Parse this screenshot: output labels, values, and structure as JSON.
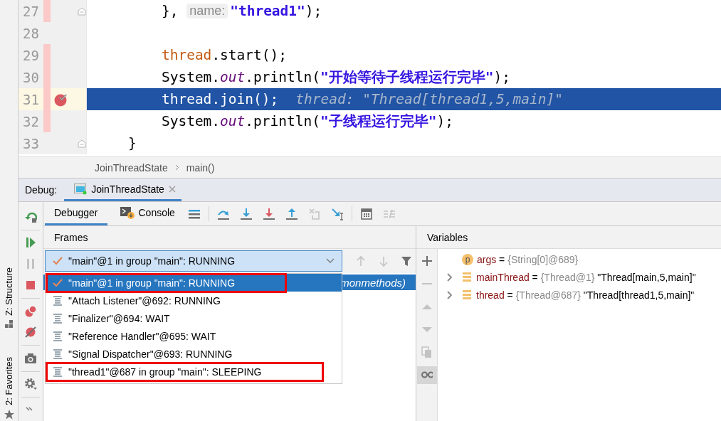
{
  "side_tool_tabs": [
    {
      "label": "Z: Structure",
      "kind": "structure"
    },
    {
      "label": "2: Favorites",
      "kind": "favorites"
    }
  ],
  "editor": {
    "lines": [
      {
        "number": "27",
        "changed": true,
        "breakpoint": false,
        "current": false,
        "fold": true,
        "segments": [
          {
            "kind": "plain",
            "text": "        }, "
          },
          {
            "kind": "hint",
            "text": "name:"
          },
          {
            "kind": "string",
            "text": "\"thread1\""
          },
          {
            "kind": "plain",
            "text": ");"
          }
        ]
      },
      {
        "number": "28",
        "changed": false,
        "breakpoint": false,
        "current": false,
        "fold": false
      },
      {
        "number": "29",
        "changed": true,
        "breakpoint": false,
        "current": false,
        "fold": false,
        "segments": [
          {
            "kind": "local",
            "text": "        thread"
          },
          {
            "kind": "plain",
            "text": ".start();"
          }
        ]
      },
      {
        "number": "30",
        "changed": true,
        "breakpoint": false,
        "current": false,
        "fold": false,
        "segments": [
          {
            "kind": "plain",
            "text": "        System."
          },
          {
            "kind": "static",
            "text": "out"
          },
          {
            "kind": "plain",
            "text": ".println("
          },
          {
            "kind": "string",
            "text": "\"开始等待子线程运行完毕\""
          },
          {
            "kind": "plain",
            "text": ");"
          }
        ]
      },
      {
        "number": "31",
        "changed": true,
        "breakpoint": true,
        "current": true,
        "fold": false,
        "segments": [
          {
            "kind": "local",
            "text": "        thread"
          },
          {
            "kind": "plain",
            "text": ".join();"
          },
          {
            "kind": "inline_value",
            "text": "thread: \"Thread[thread1,5,main]\""
          }
        ]
      },
      {
        "number": "32",
        "changed": true,
        "breakpoint": false,
        "current": false,
        "fold": false,
        "segments": [
          {
            "kind": "plain",
            "text": "        System."
          },
          {
            "kind": "static",
            "text": "out"
          },
          {
            "kind": "plain",
            "text": ".println("
          },
          {
            "kind": "string",
            "text": "\"子线程运行完毕\""
          },
          {
            "kind": "plain",
            "text": ");"
          }
        ]
      },
      {
        "number": "33",
        "changed": false,
        "breakpoint": false,
        "current": false,
        "fold": true,
        "segments": [
          {
            "kind": "plain",
            "text": "    }"
          }
        ]
      }
    ]
  },
  "breadcrumbs": [
    "JoinThreadState",
    "main()"
  ],
  "debug": {
    "label": "Debug:",
    "tabs": [
      {
        "label": "JoinThreadState",
        "selected": true
      }
    ],
    "side_actions": [
      {
        "kind": "rerun",
        "disabled": false
      },
      {
        "kind": "resume",
        "disabled": false
      },
      {
        "kind": "pause",
        "disabled": true
      },
      {
        "kind": "stop",
        "disabled": false
      },
      {
        "kind": "breakpoints",
        "disabled": false
      },
      {
        "kind": "mute",
        "disabled": false
      },
      {
        "kind": "camera",
        "disabled": false
      },
      {
        "kind": "settings",
        "disabled": false
      },
      {
        "kind": "more",
        "disabled": false
      }
    ],
    "view_tabs": [
      {
        "label": "Debugger",
        "selected": true,
        "kind": "debugger"
      },
      {
        "label": "Console",
        "selected": false,
        "kind": "console"
      }
    ],
    "actions": [
      {
        "kind": "layout",
        "disabled": false
      },
      {
        "kind": "step_over",
        "disabled": false
      },
      {
        "kind": "step_into",
        "disabled": false
      },
      {
        "kind": "force_step_into",
        "disabled": false
      },
      {
        "kind": "step_out",
        "disabled": false
      },
      {
        "kind": "drop_frame",
        "disabled": true
      },
      {
        "kind": "run_to_cursor",
        "disabled": false
      },
      {
        "kind": "evaluate",
        "disabled": false
      },
      {
        "kind": "trace",
        "disabled": true
      }
    ]
  },
  "frames": {
    "title": "Frames",
    "thread_selector": {
      "value": "\"main\"@1 in group \"main\": RUNNING"
    },
    "nav": [
      {
        "kind": "up",
        "disabled": true
      },
      {
        "kind": "down",
        "disabled": true
      },
      {
        "kind": "filter",
        "disabled": false
      }
    ],
    "list": [
      {
        "text": "monmethods)",
        "selected": true
      }
    ],
    "popup": [
      {
        "kind": "current",
        "text": "\"main\"@1 in group \"main\": RUNNING",
        "selected": true,
        "highlighted": true
      },
      {
        "kind": "thread",
        "text": "\"Attach Listener\"@692: RUNNING",
        "selected": false,
        "highlighted": false
      },
      {
        "kind": "thread",
        "text": "\"Finalizer\"@694: WAIT",
        "selected": false,
        "highlighted": false
      },
      {
        "kind": "thread",
        "text": "\"Reference Handler\"@695: WAIT",
        "selected": false,
        "highlighted": false
      },
      {
        "kind": "thread",
        "text": "\"Signal Dispatcher\"@693: RUNNING",
        "selected": false,
        "highlighted": false
      },
      {
        "kind": "thread",
        "text": "\"thread1\"@687 in group \"main\": SLEEPING",
        "selected": false,
        "highlighted": true
      }
    ]
  },
  "variables": {
    "title": "Variables",
    "side_actions": [
      {
        "kind": "add",
        "disabled": false,
        "selected": false
      },
      {
        "kind": "remove",
        "disabled": true,
        "selected": false
      },
      {
        "kind": "up",
        "disabled": true,
        "selected": false
      },
      {
        "kind": "down",
        "disabled": true,
        "selected": false
      },
      {
        "kind": "copy",
        "disabled": true,
        "selected": false
      },
      {
        "kind": "watches",
        "disabled": false,
        "selected": true
      }
    ],
    "rows": [
      {
        "kind": "param",
        "badge": "p",
        "expandable": false,
        "name": "args",
        "operator": "=",
        "type": "{String[0]@689}"
      },
      {
        "kind": "field",
        "expandable": true,
        "name": "mainThread",
        "operator": "=",
        "type": "{Thread@1}",
        "value": "\"Thread[main,5,main]\""
      },
      {
        "kind": "field",
        "expandable": true,
        "name": "thread",
        "operator": "=",
        "type": "{Thread@687}",
        "value": "\"Thread[thread1,5,main]\""
      }
    ]
  }
}
